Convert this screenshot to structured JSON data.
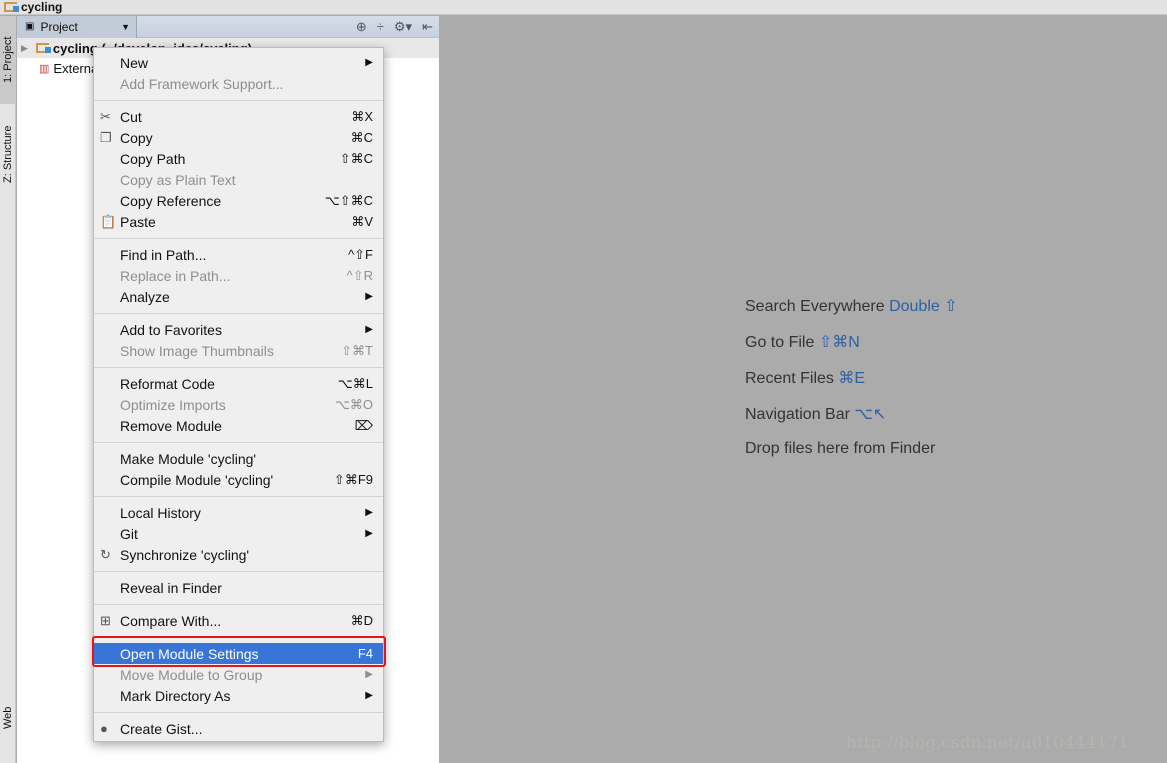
{
  "navbar": {
    "crumb": "cycling"
  },
  "side_tabs": {
    "project": "1: Project",
    "structure": "Z: Structure",
    "web": "Web"
  },
  "panel": {
    "selector": "Project",
    "tree": [
      {
        "label": "cycling (~/develop_idea/cycling)"
      },
      {
        "label": "External Libraries"
      }
    ]
  },
  "menu": {
    "groups": [
      [
        {
          "label": "New",
          "submenu": true
        },
        {
          "label": "Add Framework Support...",
          "disabled": true
        }
      ],
      [
        {
          "label": "Cut",
          "shortcut": "⌘X",
          "icon": "✂"
        },
        {
          "label": "Copy",
          "shortcut": "⌘C",
          "icon": "❐"
        },
        {
          "label": "Copy Path",
          "shortcut": "⇧⌘C"
        },
        {
          "label": "Copy as Plain Text",
          "disabled": true
        },
        {
          "label": "Copy Reference",
          "shortcut": "⌥⇧⌘C"
        },
        {
          "label": "Paste",
          "shortcut": "⌘V",
          "icon": "📋"
        }
      ],
      [
        {
          "label": "Find in Path...",
          "shortcut": "^⇧F"
        },
        {
          "label": "Replace in Path...",
          "shortcut": "^⇧R",
          "disabled": true
        },
        {
          "label": "Analyze",
          "submenu": true
        }
      ],
      [
        {
          "label": "Add to Favorites",
          "submenu": true
        },
        {
          "label": "Show Image Thumbnails",
          "shortcut": "⇧⌘T",
          "disabled": true
        }
      ],
      [
        {
          "label": "Reformat Code",
          "shortcut": "⌥⌘L"
        },
        {
          "label": "Optimize Imports",
          "shortcut": "⌥⌘O",
          "disabled": true
        },
        {
          "label": "Remove Module",
          "shortcut": "⌦"
        }
      ],
      [
        {
          "label": "Make Module 'cycling'"
        },
        {
          "label": "Compile Module 'cycling'",
          "shortcut": "⇧⌘F9"
        }
      ],
      [
        {
          "label": "Local History",
          "submenu": true
        },
        {
          "label": "Git",
          "submenu": true
        },
        {
          "label": "Synchronize 'cycling'",
          "icon": "↻"
        }
      ],
      [
        {
          "label": "Reveal in Finder"
        }
      ],
      [
        {
          "label": "Compare With...",
          "shortcut": "⌘D",
          "icon": "⊞"
        }
      ],
      [
        {
          "label": "Open Module Settings",
          "shortcut": "F4",
          "selected": true
        },
        {
          "label": "Move Module to Group",
          "submenu": true,
          "disabled": true
        },
        {
          "label": "Mark Directory As",
          "submenu": true
        }
      ],
      [
        {
          "label": "Create Gist...",
          "icon": "●"
        }
      ]
    ]
  },
  "hints": [
    {
      "text": "Search Everywhere",
      "key": "Double ⇧"
    },
    {
      "text": "Go to File",
      "key": "⇧⌘N"
    },
    {
      "text": "Recent Files",
      "key": "⌘E"
    },
    {
      "text": "Navigation Bar",
      "key": "⌥↖"
    },
    {
      "text": "Drop files here from Finder",
      "key": ""
    }
  ],
  "watermark": "http://blog.csdn.net/u010444171",
  "colors": {
    "selection": "#3875d7",
    "highlight_box": "#e0161d",
    "hint_key": "#2e5fa5"
  }
}
